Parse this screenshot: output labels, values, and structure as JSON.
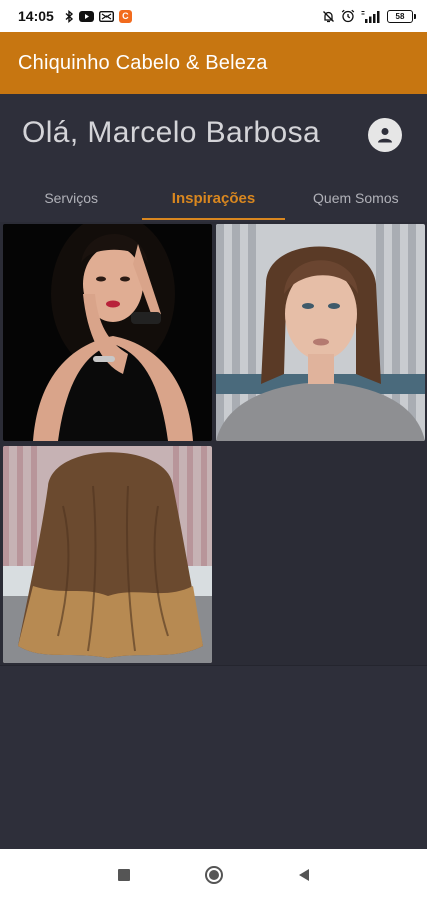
{
  "status_bar": {
    "time": "14:05",
    "left_icons": [
      "bluetooth-icon",
      "youtube-icon",
      "cast-icon",
      "app-notification-icon"
    ],
    "right_icons": [
      "mute-icon",
      "alarm-icon",
      "signal-icon"
    ],
    "battery": "58"
  },
  "app_bar": {
    "title": "Chiquinho Cabelo & Beleza",
    "color": "#c77611"
  },
  "greeting": {
    "text": "Olá, Marcelo Barbosa"
  },
  "tabs": [
    {
      "label": "Serviços",
      "active": false
    },
    {
      "label": "Inspirações",
      "active": true
    },
    {
      "label": "Quem Somos",
      "active": false
    }
  ],
  "accent_color": "#d9871f",
  "gallery": {
    "items": [
      {
        "subject": "woman-dark-hair-black-background"
      },
      {
        "subject": "woman-brown-hair-gray-sweater"
      },
      {
        "subject": "back-view-layered-ombre-hair"
      }
    ]
  },
  "nav_bar": {
    "buttons": [
      "recents-square-icon",
      "home-circle-icon",
      "back-triangle-icon"
    ]
  }
}
